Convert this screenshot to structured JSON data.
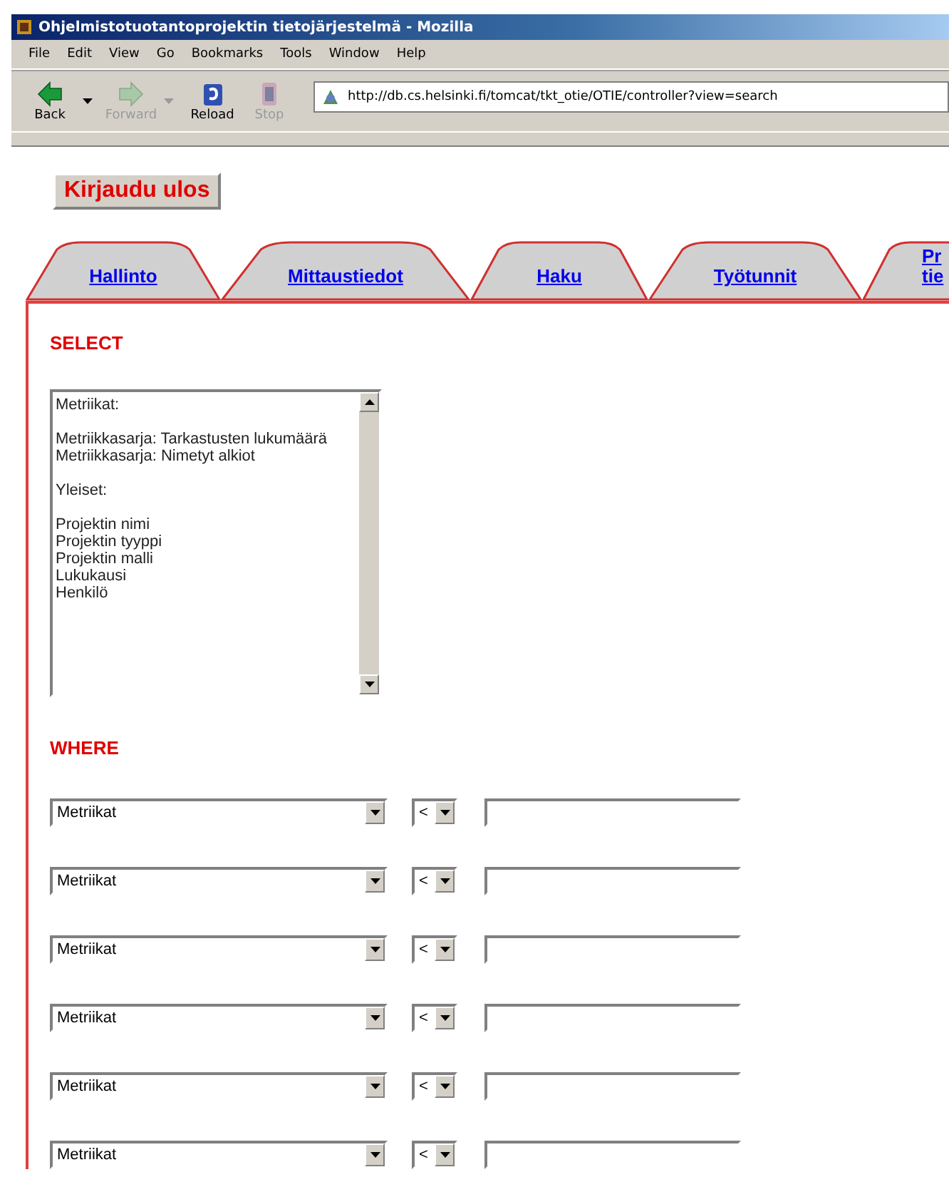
{
  "window": {
    "title": "Ohjelmistotuotantoprojektin tietojärjestelmä - Mozilla"
  },
  "menu": [
    "File",
    "Edit",
    "View",
    "Go",
    "Bookmarks",
    "Tools",
    "Window",
    "Help"
  ],
  "toolbar": [
    {
      "kind": "back",
      "label": "Back",
      "disabled": false,
      "dropdown": true
    },
    {
      "kind": "forward",
      "label": "Forward",
      "disabled": true,
      "dropdown": true
    },
    {
      "kind": "reload",
      "label": "Reload",
      "disabled": false,
      "dropdown": false
    },
    {
      "kind": "stop",
      "label": "Stop",
      "disabled": true,
      "dropdown": false
    }
  ],
  "address": {
    "value": "http://db.cs.helsinki.fi/tomcat/tkt_otie/OTIE/controller?view=search"
  },
  "logout_button": "Kirjaudu ulos",
  "tabs": [
    {
      "label": "Hallinto"
    },
    {
      "label": "Mittaustiedot"
    },
    {
      "label": "Haku"
    },
    {
      "label": "Työtunnit"
    },
    {
      "label": "Pr\ntie"
    }
  ],
  "select": {
    "heading": "SELECT",
    "groups": [
      {
        "label": "Metriikat:",
        "options": [
          "Metriikkasarja: Tarkastusten lukumäärä",
          "Metriikkasarja: Nimetyt alkiot"
        ]
      },
      {
        "label": "Yleiset:",
        "options": [
          "Projektin nimi",
          "Projektin tyyppi",
          "Projektin malli",
          "Lukukausi",
          "Henkilö"
        ]
      }
    ]
  },
  "where": {
    "heading": "WHERE",
    "rows": [
      {
        "field": "Metriikat",
        "operator": "<"
      },
      {
        "field": "Metriikat",
        "operator": "<"
      },
      {
        "field": "Metriikat",
        "operator": "<"
      },
      {
        "field": "Metriikat",
        "operator": "<"
      },
      {
        "field": "Metriikat",
        "operator": "<"
      },
      {
        "field": "Metriikat",
        "operator": "<"
      }
    ]
  }
}
